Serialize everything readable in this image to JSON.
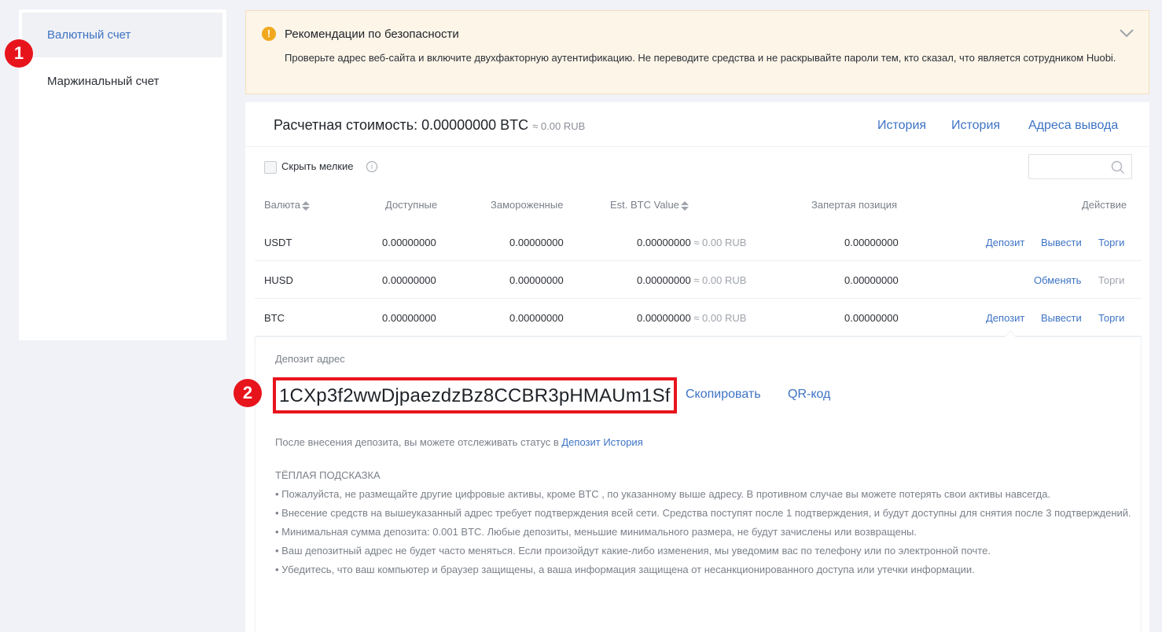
{
  "sidebar": {
    "items": [
      {
        "label": "Валютный счет",
        "active": true
      },
      {
        "label": "Маржинальный счет",
        "active": false
      }
    ]
  },
  "markers": [
    "1",
    "2"
  ],
  "banner": {
    "icon": "warning-icon",
    "title": "Рекомендации по безопасности",
    "text": "Проверьте адрес веб-сайта и включите двухфакторную аутентификацию. Не переводите средства и не раскрывайте пароли тем, кто сказал, что является сотрудником Huobi."
  },
  "header": {
    "estimate_label": "Расчетная стоимость: 0.00000000 BTC",
    "estimate_sub": "≈ 0.00 RUB",
    "links": [
      "История",
      "История",
      "Адреса вывода"
    ]
  },
  "filter": {
    "hide_small_label": "Скрыть мелкие",
    "search_placeholder": ""
  },
  "table": {
    "columns": [
      "Валюта",
      "Доступные",
      "Замороженные",
      "Est. BTC Value",
      "Запертая позиция",
      "Действие"
    ],
    "rows": [
      {
        "currency": "USDT",
        "available": "0.00000000",
        "frozen": "0.00000000",
        "btc_value": "0.00000000",
        "btc_rub": "≈ 0.00 RUB",
        "locked": "0.00000000",
        "actions": [
          "Депозит",
          "Вывести",
          "Торги"
        ]
      },
      {
        "currency": "HUSD",
        "available": "0.00000000",
        "frozen": "0.00000000",
        "btc_value": "0.00000000",
        "btc_rub": "≈ 0.00 RUB",
        "locked": "0.00000000",
        "actions": [
          "Обменять",
          "Торги"
        ]
      },
      {
        "currency": "BTC",
        "available": "0.00000000",
        "frozen": "0.00000000",
        "btc_value": "0.00000000",
        "btc_rub": "≈ 0.00 RUB",
        "locked": "0.00000000",
        "actions": [
          "Депозит",
          "Вывести",
          "Торги"
        ]
      }
    ]
  },
  "deposit": {
    "label": "Депозит адрес",
    "address": "1CXp3f2wwDjpaezdzBz8CCBR3pHMAUm1Sf",
    "copy": "Скопировать",
    "qr": "QR-код",
    "after_text": "После внесения депозита, вы можете отслеживать статус в",
    "after_link": "Депозит История",
    "tips_title": "ТЁПЛАЯ ПОДСКАЗКА",
    "tips": [
      "• Пожалуйста, не размещайте другие цифровые активы, кроме BTC , по указанному выше адресу. В противном случае вы можете потерять свои активы навсегда.",
      "• Внесение средств на вышеуказанный адрес требует подтверждения всей сети. Средства поступят после 1 подтверждения, и будут доступны для снятия после 3 подтверждений.",
      "• Минимальная сумма депозита: 0.001 BTC. Любые депозиты, меньшие минимального размера, не будут зачислены или возвращены.",
      "• Ваш депозитный адрес не будет часто меняться. Если произойдут какие-либо изменения, мы уведомим вас по телефону или по электронной почте.",
      "• Убедитесь, что ваш компьютер и браузер защищены, а ваша информация защищена от несанкционированного доступа или утечки информации."
    ]
  }
}
